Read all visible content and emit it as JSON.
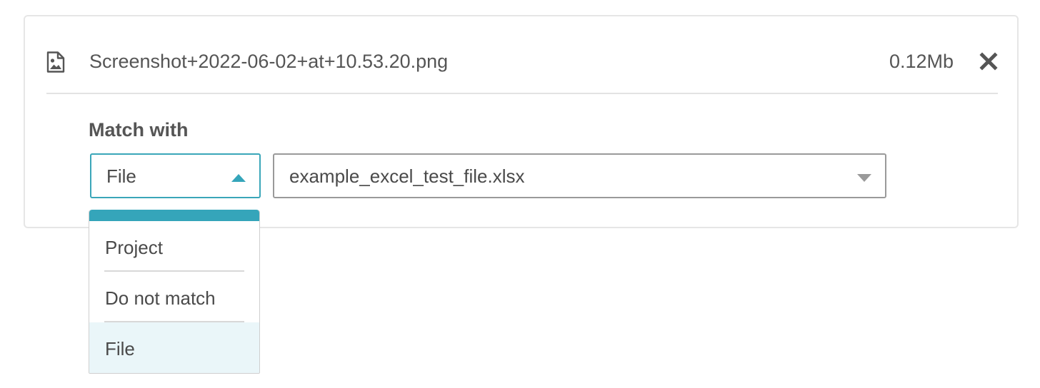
{
  "attachment": {
    "file_name": "Screenshot+2022-06-02+at+10.53.20.png",
    "file_size": "0.12Mb",
    "file_icon": "image-file-icon",
    "close_icon": "close-icon"
  },
  "match": {
    "label": "Match with",
    "type_select": {
      "value": "File",
      "caret_icon": "caret-up-icon",
      "open": true
    },
    "file_select": {
      "value": "example_excel_test_file.xlsx",
      "caret_icon": "caret-down-icon"
    },
    "options": [
      {
        "label": "Project"
      },
      {
        "label": "Do not match"
      },
      {
        "label": "File",
        "selected": true
      }
    ]
  },
  "colors": {
    "accent": "#35a5ba",
    "selected_bg": "#eaf6f9",
    "text": "#4a4a4a",
    "border": "#e6e6e6"
  }
}
